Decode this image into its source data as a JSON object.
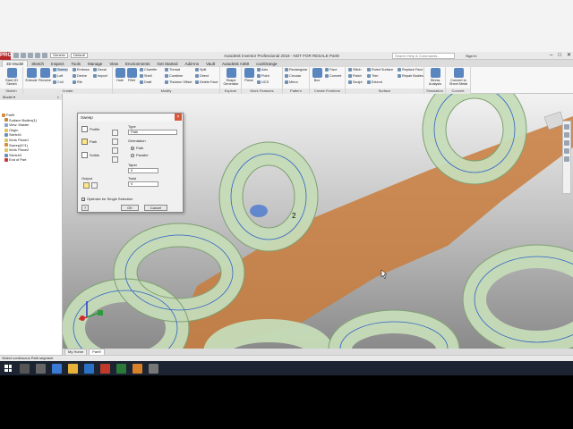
{
  "app": {
    "title": "Autodesk Inventor Professional 2018 - NOT FOR RESALE  Part9",
    "logo": "PRO",
    "appearance_combo": "Generic",
    "material_combo": "Default",
    "search_placeholder": "Search Help & Commands...",
    "user": "Sign In",
    "win_controls": [
      "–",
      "□",
      "✕"
    ]
  },
  "tabs": [
    "3D Model",
    "Sketch",
    "Inspect",
    "Tools",
    "Manage",
    "View",
    "Environments",
    "Get Started",
    "Add-Ins",
    "Vault",
    "Autodesk A360",
    "coolOrange"
  ],
  "active_tab": "3D Model",
  "ribbon": {
    "sketch_panel": {
      "label": "Sketch",
      "start": "Start 2D Sketch"
    },
    "create_panel": {
      "label": "Create",
      "extrude": "Extrude",
      "revolve": "Revolve",
      "sweep": "Sweep",
      "loft": "Loft",
      "coil": "Coil",
      "emboss": "Emboss",
      "derive": "Derive",
      "rib": "Rib",
      "decal": "Decal",
      "import": "Import"
    },
    "modify_panel": {
      "label": "Modify",
      "hole": "Hole",
      "fillet": "Fillet",
      "chamfer": "Chamfer",
      "shell": "Shell",
      "draft": "Draft",
      "thread": "Thread",
      "combine": "Combine",
      "thicken": "Thicken/ Offset",
      "split": "Split",
      "direct": "Direct",
      "delete_face": "Delete Face"
    },
    "explore_panel": {
      "label": "Explore",
      "shape_gen": "Shape Generator"
    },
    "work_panel": {
      "label": "Work Features",
      "plane": "Plane",
      "axis": "Axis",
      "point": "Point",
      "ucs": "UCS"
    },
    "pattern_panel": {
      "label": "Pattern",
      "rectangular": "Rectangular",
      "circular": "Circular",
      "mirror": "Mirror"
    },
    "freeform_panel": {
      "label": "Create Freeform",
      "box": "Box",
      "face": "Face",
      "convert": "Convert"
    },
    "surface_panel": {
      "label": "Surface",
      "stitch": "Stitch",
      "patch": "Patch",
      "sculpt": "Sculpt",
      "trim": "Trim",
      "extend": "Extend",
      "ruled": "Ruled Surface",
      "replace": "Replace Face",
      "repair": "Repair Bodies"
    },
    "sim_panel": {
      "label": "Simulation",
      "stress": "Stress Analysis"
    },
    "convert_panel": {
      "label": "Convert",
      "sheet": "Convert to Sheet Metal"
    }
  },
  "browser": {
    "header": "Model ▾",
    "items": [
      {
        "label": "Part9",
        "color": "#d88a3a"
      },
      {
        "label": "Surface Bodies(1)",
        "color": "#c4883f"
      },
      {
        "label": "View: Master",
        "color": "#8aa6c6"
      },
      {
        "label": "Origin",
        "color": "#e2c35a"
      },
      {
        "label": "Sketch1",
        "color": "#6c8fb8"
      },
      {
        "label": "Work Plane1",
        "color": "#e2c35a"
      },
      {
        "label": "Sweep(9?1)",
        "color": "#d88a3a"
      },
      {
        "label": "Work Plane2",
        "color": "#e2c35a"
      },
      {
        "label": "Sketch3",
        "color": "#6c8fb8"
      },
      {
        "label": "End of Part",
        "color": "#c03a3a"
      }
    ]
  },
  "dialog": {
    "title": "Sweep",
    "profile": "Profile",
    "path": "Path",
    "solids": "Solids",
    "output": "Output",
    "type_label": "Type",
    "type_value": "Path",
    "orientation_label": "Orientation",
    "path_option": "Path",
    "parallel_option": "Parallel",
    "taper_label": "Taper",
    "taper_value": "0",
    "twist_label": "Twist",
    "twist_value": "0",
    "optimize": "Optimize for Single Selection",
    "ok": "OK",
    "cancel": "Cancel"
  },
  "viewport": {
    "label_2": "2"
  },
  "doc_tabs": [
    "My Home",
    "Part9"
  ],
  "status": "Select continuous Path segment",
  "colors": {
    "tube_fill": "#c6dcb8",
    "tube_edge": "#7fa074",
    "guide_line": "#2f62c8",
    "surface": "#c97c3c"
  }
}
